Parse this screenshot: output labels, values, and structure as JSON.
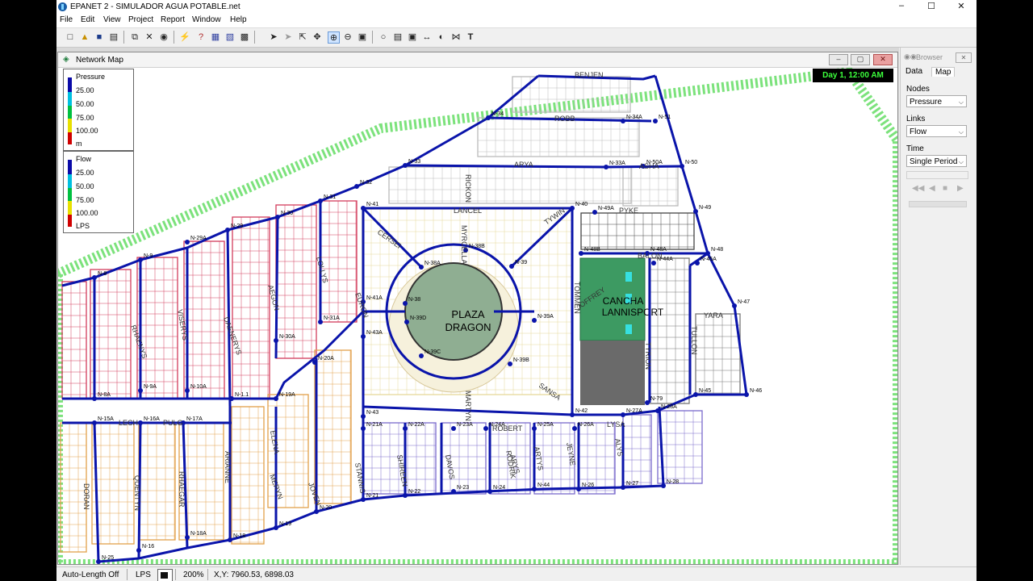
{
  "app": {
    "title": "EPANET 2 - SIMULADOR AGUA POTABLE.net",
    "window_controls": [
      "–",
      "☐",
      "✕"
    ]
  },
  "menu": [
    "File",
    "Edit",
    "View",
    "Project",
    "Report",
    "Window",
    "Help"
  ],
  "network_window": {
    "title": "Network Map",
    "time_label": "Day 1, 12:00 AM"
  },
  "legend_pressure": {
    "title": "Pressure",
    "values": [
      "25.00",
      "50.00",
      "75.00",
      "100.00"
    ],
    "unit": "m"
  },
  "legend_flow": {
    "title": "Flow",
    "values": [
      "25.00",
      "50.00",
      "75.00",
      "100.00"
    ],
    "unit": "LPS"
  },
  "legend_colors": [
    "#0a0aa8",
    "#00c0e0",
    "#00c040",
    "#e8e000",
    "#d00000"
  ],
  "browser": {
    "title": "Browser",
    "tabs": [
      "Data",
      "Map"
    ],
    "nodes_label": "Nodes",
    "nodes_value": "Pressure",
    "links_label": "Links",
    "links_value": "Flow",
    "time_label": "Time",
    "time_value": "Single Period"
  },
  "status": {
    "length": "Auto-Length Off",
    "units": "LPS",
    "zoom": "200%",
    "coords": "X,Y: 7960.53, 6898.03"
  },
  "map_text": {
    "plaza_1": "PLAZA",
    "plaza_2": "DRAGON",
    "cancha_1": "CANCHA",
    "cancha_2": "LANNISPORT"
  },
  "nodes": [
    "N-34",
    "N-34A",
    "N-51",
    "N-33",
    "N-33A",
    "N-50A",
    "N-50",
    "N-32",
    "N-41",
    "N-40",
    "N-49A",
    "N-49",
    "N-31",
    "N-30",
    "N-29",
    "N-29A",
    "N-9",
    "N-8",
    "N-38B",
    "N-38A",
    "N-39",
    "N-48B",
    "N-48A",
    "N-48",
    "N-44A",
    "N-45A",
    "N-41A",
    "N-38",
    "N-39D",
    "N-39A",
    "N-47",
    "N-31A",
    "N-30A",
    "N-43A",
    "N-39C",
    "N-39B",
    "N-20A",
    "N-10A",
    "N-9A",
    "N-8A",
    "N-19A",
    "N-1.1",
    "N-43",
    "N-42",
    "N-27A",
    "N-28A",
    "N-79",
    "N-45",
    "N-46",
    "N-15A",
    "N-16A",
    "N-17A",
    "N-21A",
    "N-22A",
    "N-23A",
    "N-24A",
    "N-25A",
    "N-26A",
    "N-21",
    "N-22",
    "N-23",
    "N-24",
    "N-44",
    "N-26",
    "N-27",
    "N-28",
    "N-20",
    "N-19",
    "N-18",
    "N-18A",
    "N-16",
    "N-25"
  ],
  "streets": [
    "BENJEN",
    "ROBB",
    "ARYA",
    "ASHA",
    "RICKON",
    "LANCEL",
    "CERSEI",
    "MYRCELLA",
    "TYWIN",
    "PYKE",
    "BALON",
    "YARA",
    "TOMMEN",
    "JOFFREY",
    "SANSA",
    "MARTYN",
    "TYRION",
    "TULLON",
    "EURON",
    "RHAENYS",
    "VISERYS",
    "DAENERYS",
    "AEGON",
    "LOLLYS",
    "ARYS",
    "LECH",
    "PULG",
    "ARIANNE",
    "ELENA",
    "DORAN",
    "QUENTYN",
    "RHAEGAR",
    "MERYN",
    "STANNIS",
    "SHIREEN",
    "DAVOS",
    "JOVEN",
    "RODRIK",
    "ARTYS",
    "JEYNE",
    "ALYS",
    "LYSA",
    "ROBERT"
  ]
}
